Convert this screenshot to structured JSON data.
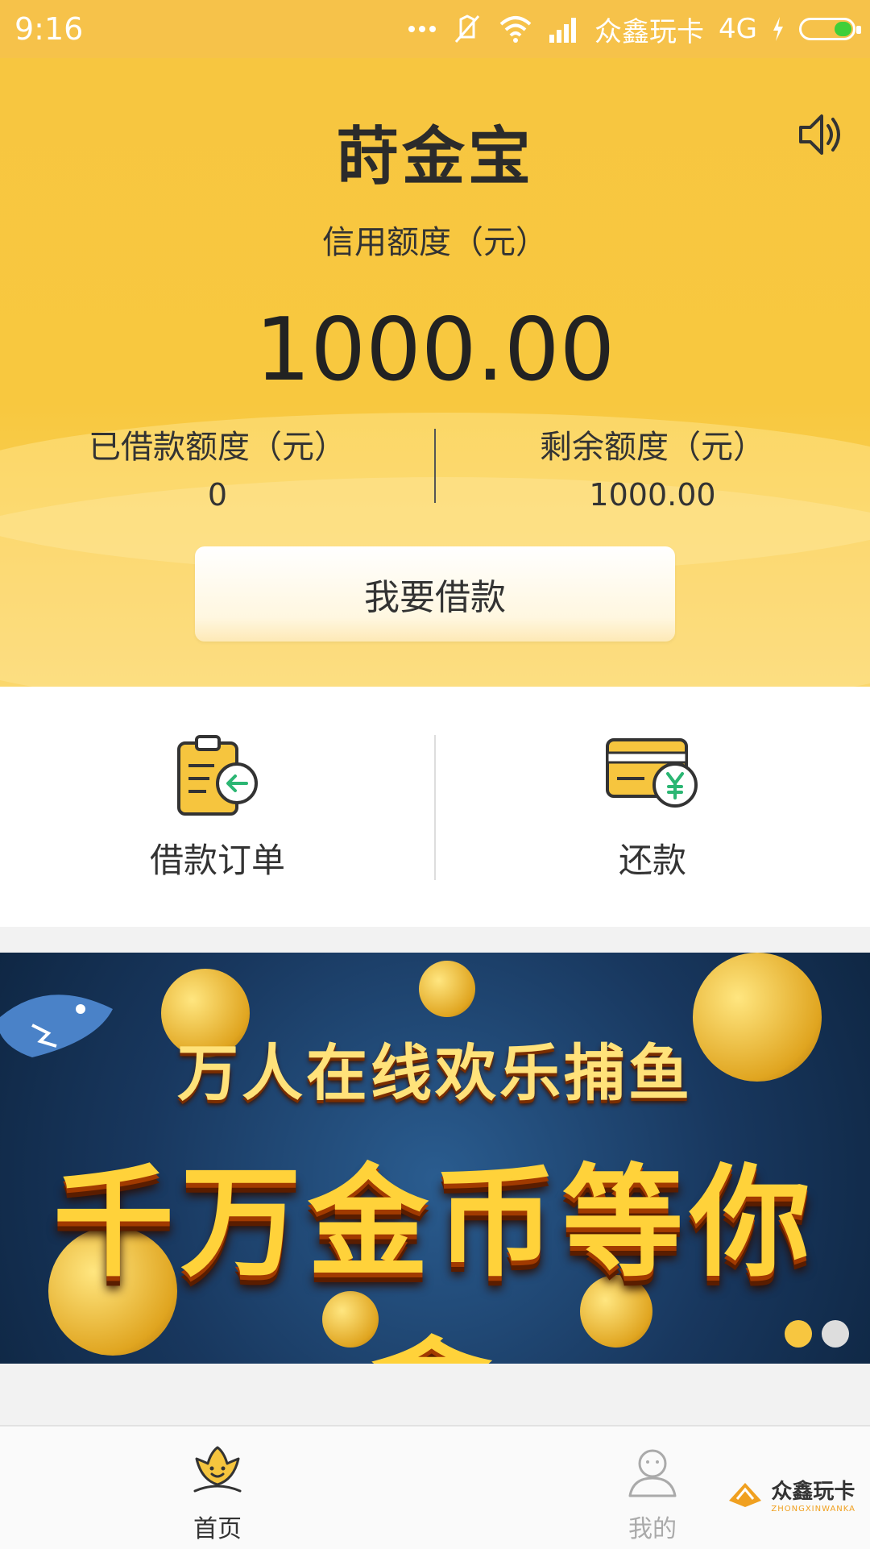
{
  "status_bar": {
    "time": "9:16",
    "carrier": "众鑫玩卡",
    "network": "4G",
    "battery_level": 0.35,
    "icons": [
      "more-dots-icon",
      "vibrate-off-icon",
      "wifi-icon",
      "signal-icon",
      "charging-icon",
      "battery-icon"
    ]
  },
  "header": {
    "logo_text": "莳金宝",
    "speaker_icon": "speaker-icon"
  },
  "credit": {
    "title": "信用额度（元）",
    "value": "1000.00"
  },
  "borrowed": {
    "label": "已借款额度（元）",
    "value": "0"
  },
  "remaining": {
    "label": "剩余额度（元）",
    "value": "1000.00"
  },
  "borrow_button": {
    "label": "我要借款"
  },
  "actions": [
    {
      "label": "借款订单",
      "icon": "clipboard-return-icon"
    },
    {
      "label": "还款",
      "icon": "card-yuan-icon"
    }
  ],
  "banner": {
    "line1": "万人在线欢乐捕鱼",
    "line2": "千万金币等你拿",
    "active_index": 0,
    "total": 2
  },
  "bottom_nav": [
    {
      "label": "首页",
      "icon": "home-flower-icon",
      "active": true
    },
    {
      "label": "我的",
      "icon": "user-icon",
      "active": false
    }
  ],
  "watermark": {
    "text": "众鑫玩卡",
    "sub": "ZHONGXINWANKA"
  },
  "colors": {
    "primary_yellow": "#f7c640",
    "text_dark": "#333333",
    "inactive_gray": "#aaaaaa",
    "dot_active": "#f7c640",
    "dot_inactive": "#dddddd"
  }
}
